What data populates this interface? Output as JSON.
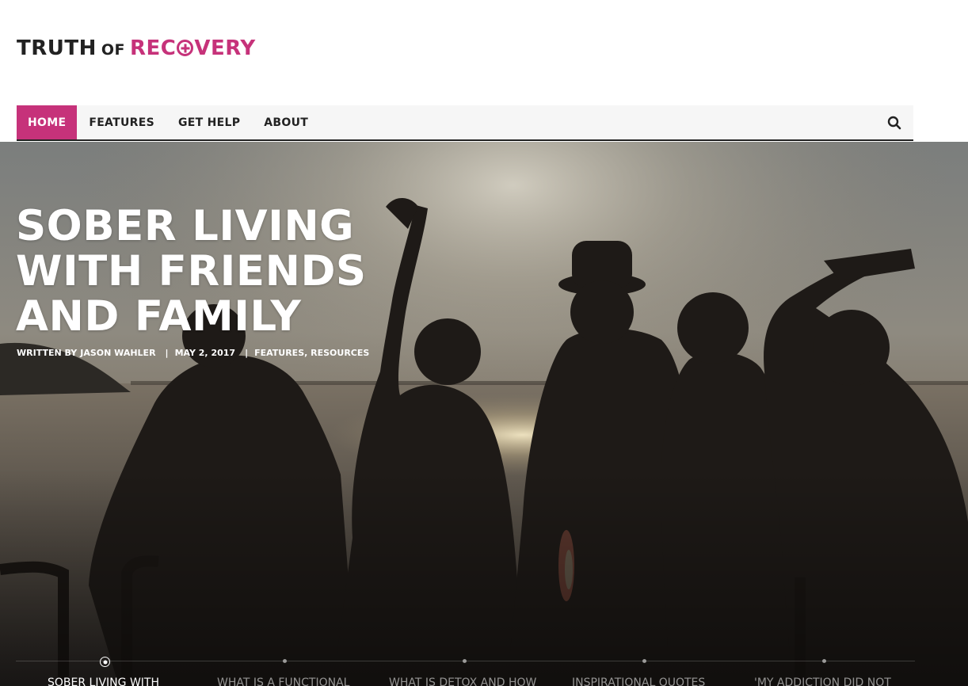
{
  "site": {
    "logo": {
      "word1": "TRUTH",
      "word2": "OF",
      "word3_pre": "REC",
      "word3_post": "VERY"
    }
  },
  "nav": {
    "items": [
      {
        "label": "HOME",
        "active": true
      },
      {
        "label": "FEATURES"
      },
      {
        "label": "GET HELP"
      },
      {
        "label": "ABOUT"
      }
    ],
    "search_icon": "search-icon"
  },
  "hero": {
    "title": "SOBER LIVING WITH FRIENDS AND FAMILY",
    "meta": {
      "author_prefix": "WRITTEN BY",
      "author": "JASON WAHLER",
      "date": "MAY 2, 2017",
      "categories": [
        "FEATURES",
        "RESOURCES"
      ]
    }
  },
  "slider": {
    "slides": [
      "SOBER LIVING WITH",
      "WHAT IS A FUNCTIONAL",
      "WHAT IS DETOX AND HOW",
      "INSPIRATIONAL QUOTES",
      "'MY ADDICTION DID NOT"
    ],
    "active_index": 0
  },
  "colors": {
    "brand": "#c6327a",
    "dark": "#222222",
    "nav_bg": "#f6f6f6"
  }
}
